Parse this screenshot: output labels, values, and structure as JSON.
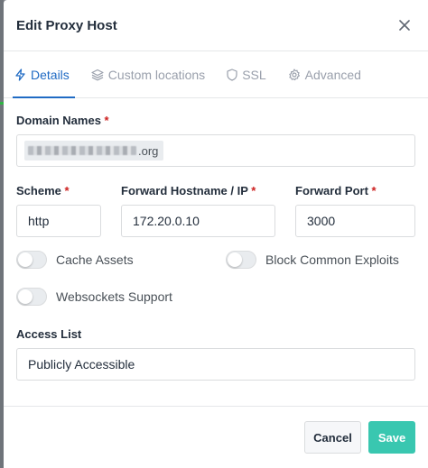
{
  "modal": {
    "title": "Edit Proxy Host"
  },
  "tabs": [
    {
      "label": "Details",
      "icon": "bolt-icon",
      "active": true
    },
    {
      "label": "Custom locations",
      "icon": "layers-icon",
      "active": false
    },
    {
      "label": "SSL",
      "icon": "shield-icon",
      "active": false
    },
    {
      "label": "Advanced",
      "icon": "gear-icon",
      "active": false
    }
  ],
  "form": {
    "domain_names": {
      "label": "Domain Names",
      "required_mark": "*",
      "tag_suffix": ".org"
    },
    "scheme": {
      "label": "Scheme",
      "required_mark": "*",
      "value": "http"
    },
    "forward_host": {
      "label": "Forward Hostname / IP",
      "required_mark": "*",
      "value": "172.20.0.10"
    },
    "forward_port": {
      "label": "Forward Port",
      "required_mark": "*",
      "value": "3000"
    },
    "toggles": {
      "cache_assets": {
        "label": "Cache Assets",
        "on": false
      },
      "block_exploits": {
        "label": "Block Common Exploits",
        "on": false
      },
      "websockets": {
        "label": "Websockets Support",
        "on": false
      }
    },
    "access_list": {
      "label": "Access List",
      "value": "Publicly Accessible"
    }
  },
  "footer": {
    "cancel_label": "Cancel",
    "save_label": "Save"
  },
  "colors": {
    "accent": "#206bc4",
    "save": "#39c7b0",
    "required": "#cd201f",
    "muted": "#9aa0ac"
  }
}
